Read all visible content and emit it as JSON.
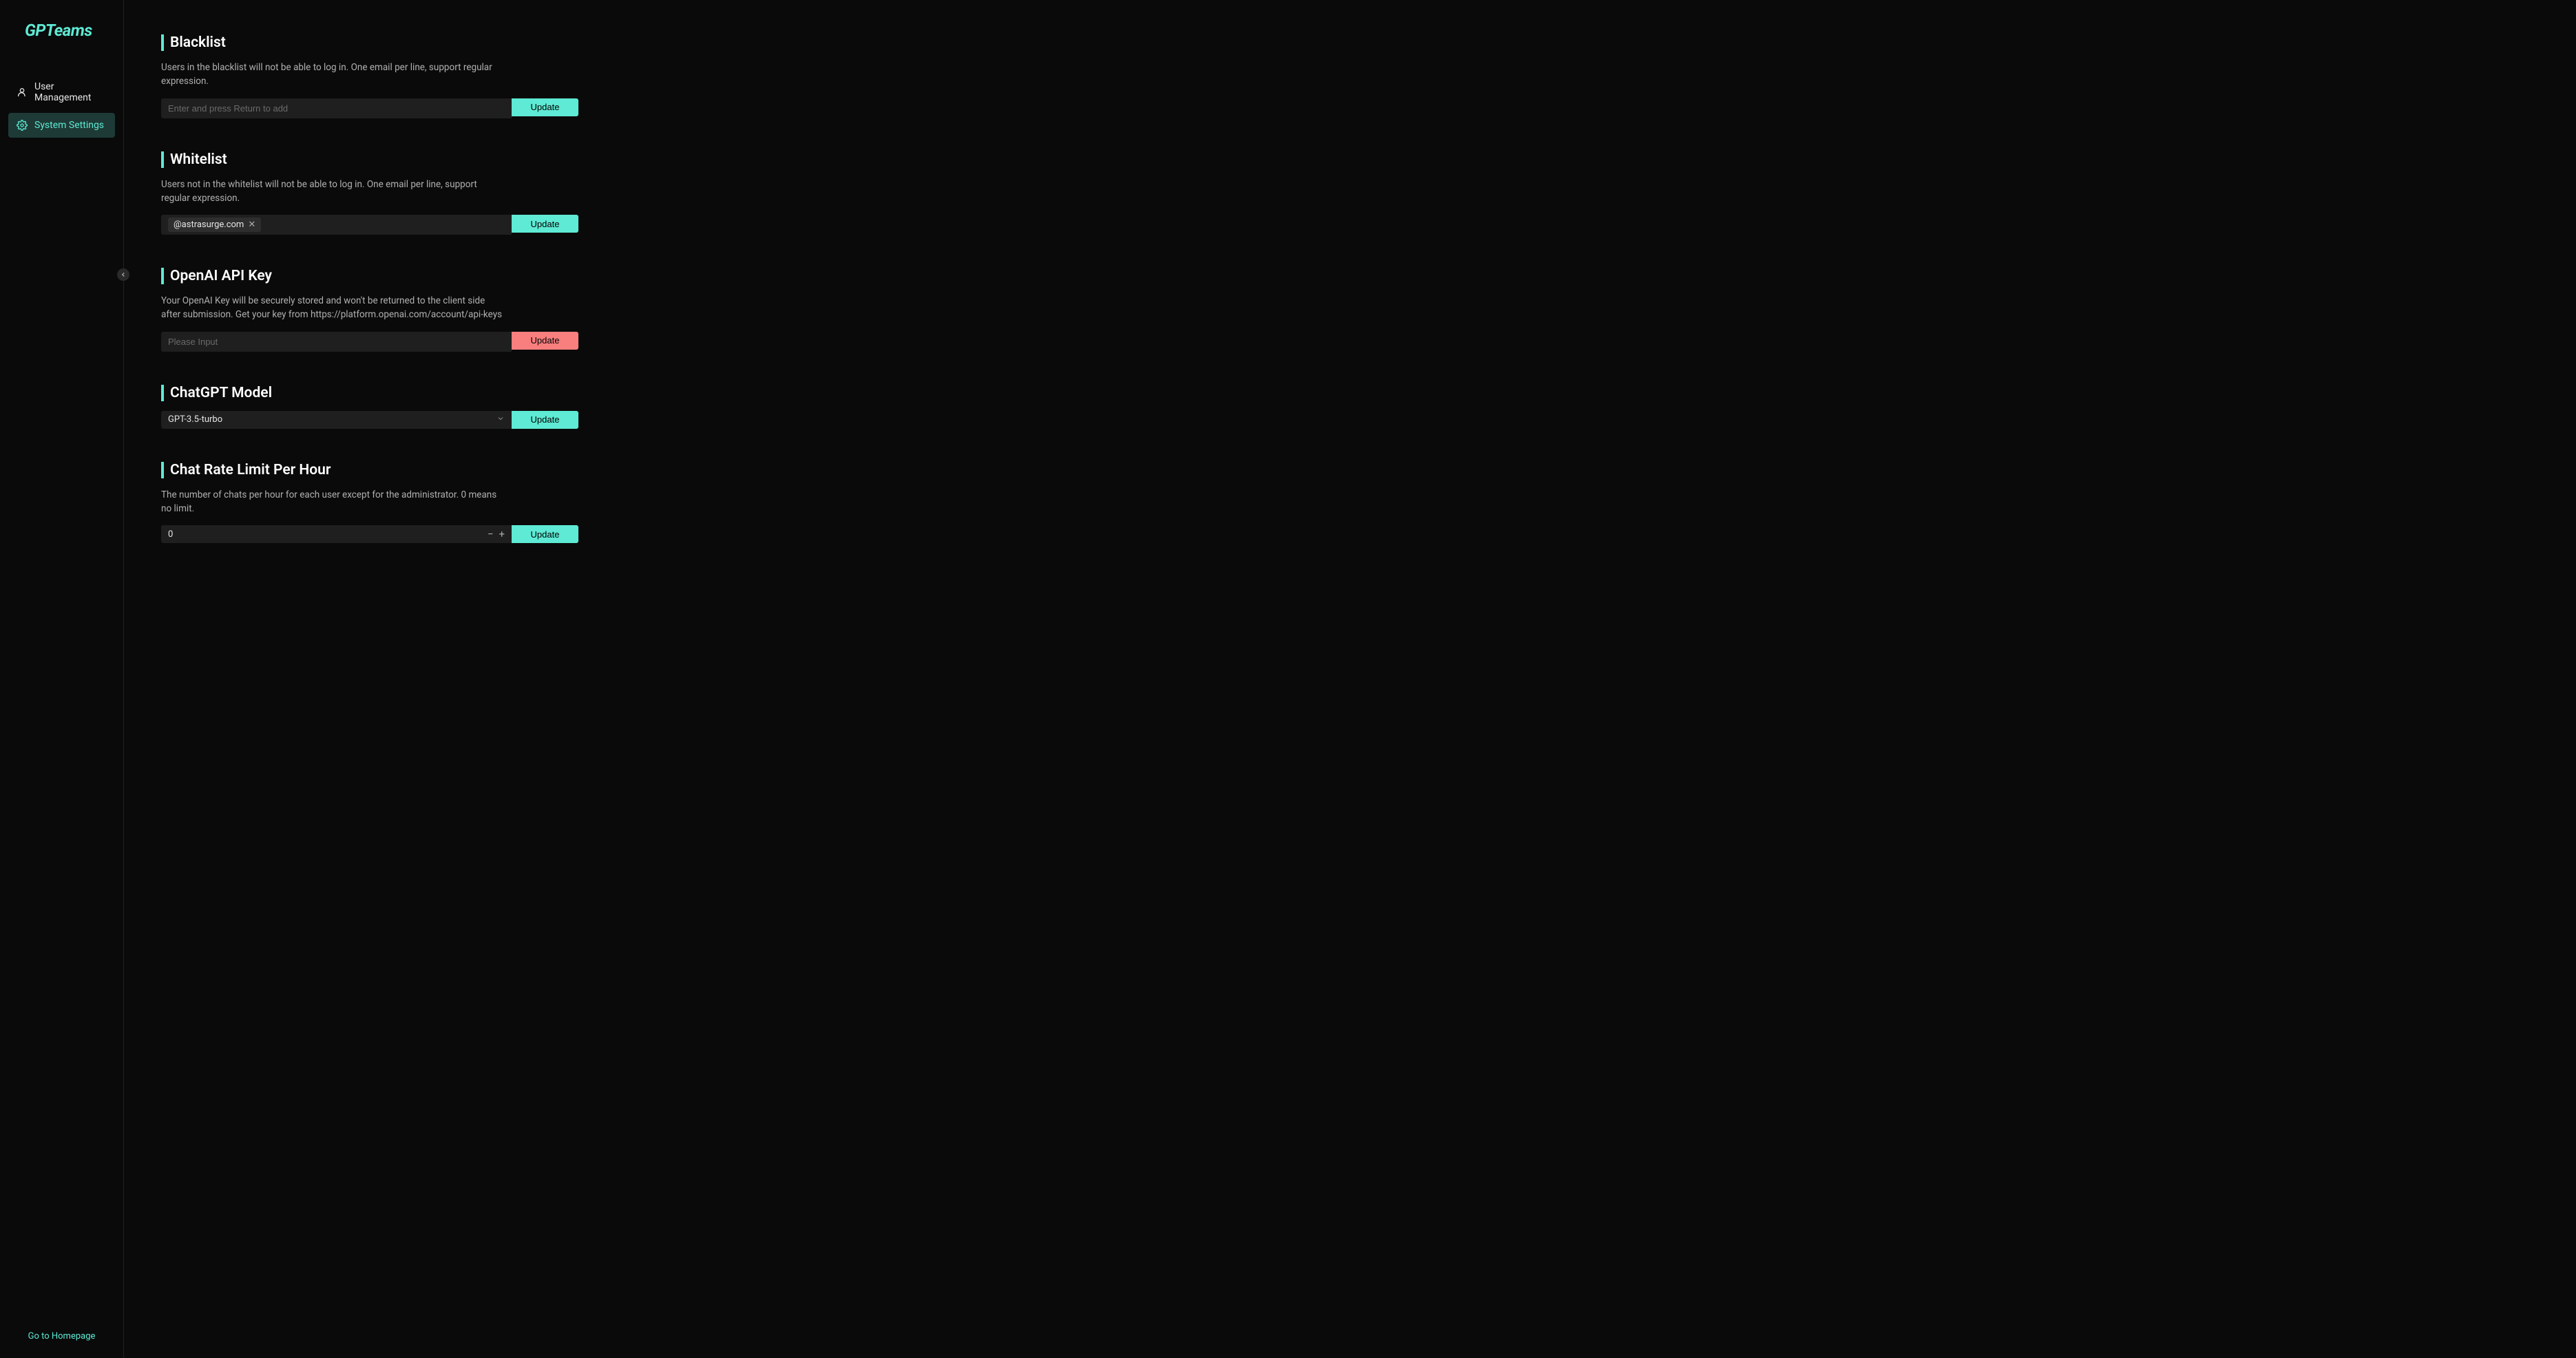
{
  "app": {
    "name": "GPTeams"
  },
  "sidebar": {
    "items": [
      {
        "label": "User Management"
      },
      {
        "label": "System Settings"
      }
    ],
    "home_link": "Go to Homepage"
  },
  "sections": {
    "blacklist": {
      "title": "Blacklist",
      "desc": "Users in the blacklist will not be able to log in. One email per line, support regular expression.",
      "placeholder": "Enter and press Return to add",
      "update_label": "Update"
    },
    "whitelist": {
      "title": "Whitelist",
      "desc": "Users not in the whitelist will not be able to log in. One email per line, support regular expression.",
      "tags": [
        "@astrasurge.com"
      ],
      "update_label": "Update"
    },
    "apikey": {
      "title": "OpenAI API Key",
      "desc": "Your OpenAI Key will be securely stored and won't be returned to the client side after submission. Get your key from https://platform.openai.com/account/api-keys",
      "placeholder": "Please Input",
      "update_label": "Update"
    },
    "model": {
      "title": "ChatGPT Model",
      "selected": "GPT-3.5-turbo",
      "update_label": "Update"
    },
    "ratelimit": {
      "title": "Chat Rate Limit Per Hour",
      "desc": "The number of chats per hour for each user except for the administrator. 0 means no limit.",
      "value": "0",
      "update_label": "Update"
    }
  }
}
